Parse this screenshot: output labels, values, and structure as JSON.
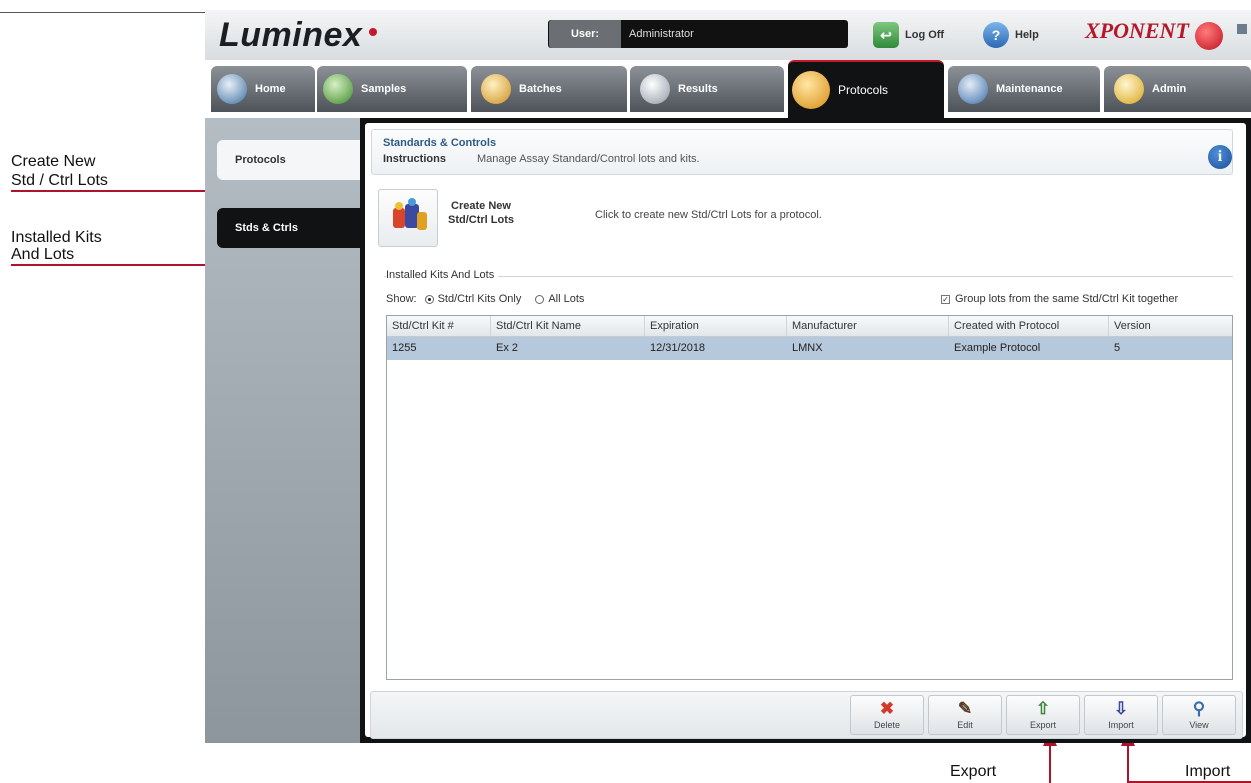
{
  "annotations": {
    "create_new_line1": "Create New",
    "create_new_line2": "Std / Ctrl Lots",
    "installed_line1": "Installed Kits",
    "installed_line2": "And Lots",
    "export": "Export",
    "import": "Import",
    "arrow_color": "#b0122b"
  },
  "header": {
    "logo": "Luminex",
    "user_label": "User:",
    "user_value": "Administrator",
    "logoff_label": "Log Off",
    "help_label": "Help",
    "brand": "XPONENT"
  },
  "nav": {
    "tabs": [
      {
        "label": "Home",
        "icon": "home-icon"
      },
      {
        "label": "Samples",
        "icon": "samples-icon"
      },
      {
        "label": "Batches",
        "icon": "batches-icon"
      },
      {
        "label": "Results",
        "icon": "results-icon"
      },
      {
        "label": "Protocols",
        "icon": "protocols-icon",
        "active": true
      },
      {
        "label": "Maintenance",
        "icon": "maintenance-icon"
      },
      {
        "label": "Admin",
        "icon": "admin-icon"
      }
    ]
  },
  "sidebar": {
    "items": [
      {
        "label": "Protocols"
      },
      {
        "label": "Stds & Ctrls",
        "active": true
      }
    ]
  },
  "panel": {
    "title": "Standards & Controls",
    "instructions_label": "Instructions",
    "instructions_text": "Manage Assay Standard/Control lots and kits.",
    "create_label": "Create New Std/Ctrl Lots",
    "create_desc": "Click to create new Std/Ctrl Lots for a protocol.",
    "group_title": "Installed Kits And Lots",
    "show_label": "Show:",
    "show_options": [
      "Std/Ctrl Kits Only",
      "All Lots"
    ],
    "show_selected": "Std/Ctrl Kits Only",
    "group_lots_label": "Group lots from the same Std/Ctrl Kit together",
    "group_lots_checked": true
  },
  "table": {
    "columns": [
      "Std/Ctrl Kit #",
      "Std/Ctrl Kit Name",
      "Expiration",
      "Manufacturer",
      "Created with Protocol",
      "Version"
    ],
    "rows": [
      [
        "1255",
        "Ex 2",
        "12/31/2018",
        "LMNX",
        "Example Protocol",
        "5"
      ]
    ],
    "selected_row_color": "#b6c8dc"
  },
  "footer": {
    "buttons": [
      {
        "label": "Delete",
        "icon": "delete-icon"
      },
      {
        "label": "Edit",
        "icon": "edit-icon"
      },
      {
        "label": "Export",
        "icon": "export-icon"
      },
      {
        "label": "Import",
        "icon": "import-icon"
      },
      {
        "label": "View",
        "icon": "view-icon"
      }
    ]
  }
}
